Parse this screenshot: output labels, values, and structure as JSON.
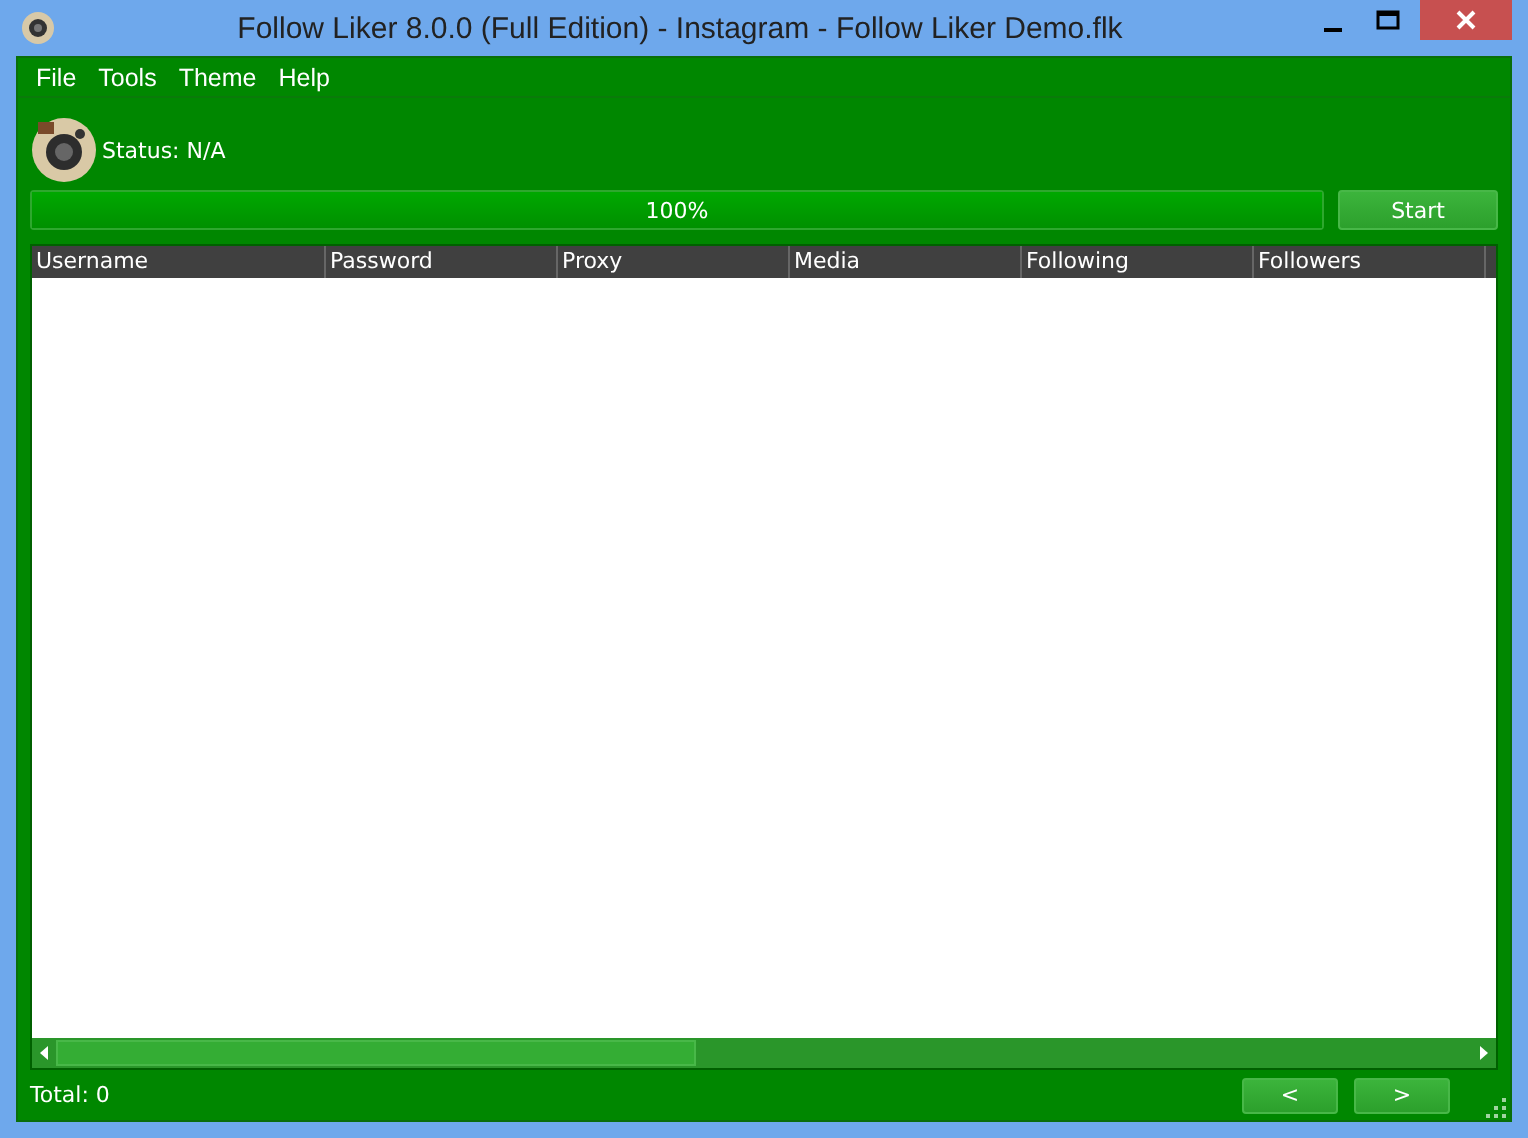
{
  "window": {
    "title": "Follow Liker 8.0.0 (Full Edition) - Instagram - Follow Liker Demo.flk"
  },
  "menu": [
    "File",
    "Tools",
    "Theme",
    "Help"
  ],
  "status": "Status: N/A",
  "progress": {
    "level": 1,
    "reading": "100%"
  },
  "start_button": "Start",
  "table": {
    "columns": [
      "Username",
      "Password",
      "Proxy",
      "Media",
      "Following",
      "Followers"
    ]
  },
  "total": "Total: 0",
  "pager": [
    "<",
    ">"
  ]
}
